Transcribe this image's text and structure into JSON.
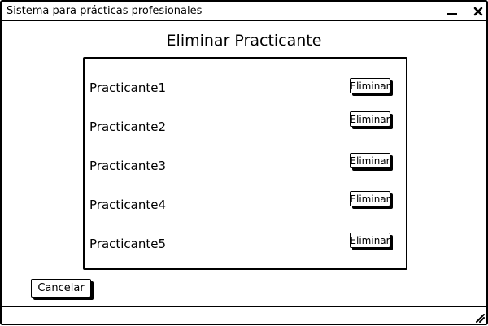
{
  "window": {
    "title": "Sistema para prácticas profesionales",
    "minimize_icon": "minimize-icon",
    "close_icon": "close-icon",
    "resize_icon": "resize-grip-icon"
  },
  "page": {
    "title": "Eliminar Practicante"
  },
  "practicantes": [
    {
      "name": "Practicante1",
      "action_label": "Eliminar"
    },
    {
      "name": "Practicante2",
      "action_label": "Eliminar"
    },
    {
      "name": "Practicante3",
      "action_label": "Eliminar"
    },
    {
      "name": "Practicante4",
      "action_label": "Eliminar"
    },
    {
      "name": "Practicante5",
      "action_label": "Eliminar"
    }
  ],
  "actions": {
    "cancel_label": "Cancelar"
  },
  "colors": {
    "stroke": "#000000",
    "background": "#ffffff"
  }
}
